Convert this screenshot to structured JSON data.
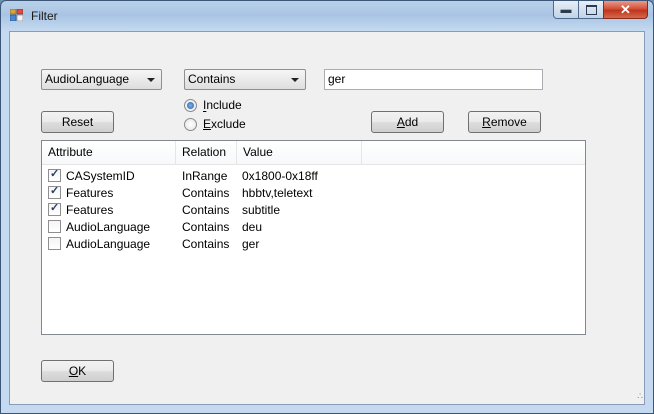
{
  "window": {
    "title": "Filter"
  },
  "filter": {
    "attribute_value": "AudioLanguage",
    "relation_value": "Contains",
    "text_value": "ger",
    "include_label": "Include",
    "exclude_label": "Exclude",
    "include_checked": true
  },
  "buttons": {
    "reset": "Reset",
    "add": "Add",
    "remove": "Remove",
    "ok": "OK"
  },
  "list": {
    "headers": [
      "Attribute",
      "Relation",
      "Value"
    ],
    "rows": [
      {
        "checked": true,
        "attribute": "CASystemID",
        "relation": "InRange",
        "value": "0x1800-0x18ff"
      },
      {
        "checked": true,
        "attribute": "Features",
        "relation": "Contains",
        "value": "hbbtv,teletext"
      },
      {
        "checked": true,
        "attribute": "Features",
        "relation": "Contains",
        "value": "subtitle"
      },
      {
        "checked": false,
        "attribute": "AudioLanguage",
        "relation": "Contains",
        "value": "deu"
      },
      {
        "checked": false,
        "attribute": "AudioLanguage",
        "relation": "Contains",
        "value": "ger"
      }
    ]
  }
}
